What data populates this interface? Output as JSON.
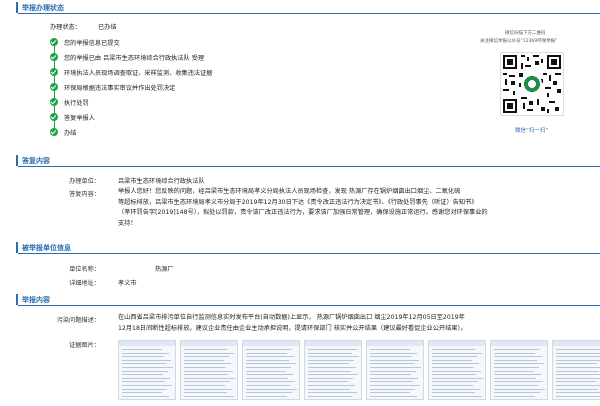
{
  "status_section": {
    "title": "举报办理状态",
    "status_label": "办理状态：",
    "status_value": "已办结",
    "steps": [
      "您的举报信息已提交",
      "您的举报已由 吕梁市生态环境综合行政执法队 受理",
      "环境执法人员现场调查取证、采样监测、收集违法证据",
      "环保局根据违法事实审议并作出处罚决定",
      "执行处罚",
      "答复举报人",
      "办结"
    ],
    "qr_line1": "微信扫描下方二维码",
    "qr_line2": "关注微信举报公众号“12369环保举报”",
    "qr_caption": "微信“扫一扫”"
  },
  "reply_section": {
    "title": "答复内容",
    "unit_label": "办理单位：",
    "unit_value": "吕梁市生态环境综合行政执法队",
    "content_label": "答复内容：",
    "content_lines": [
      "举报人您好！您反映的问题，经吕梁市生态环境局孝义分局执法人员现场检查，发现                  热源厂存在锅炉烟囱出口烟尘、二氧化硫",
      "等超标排放，吕梁市生态环境局孝义市分局于2019年12月30日下达《责令改正违法行为决定书》、《行政处罚事先（听证）告知书》",
      "（孝环罚告字[2019]148号），拟处以罚款，责令该厂改正违法行为，要求该厂加强日常管理，确保设施正常运行。感谢您对环保事业的",
      "支持！"
    ]
  },
  "unit_section": {
    "title": "被举报单位信息",
    "name_label": "单位名称：",
    "name_value": "热源厂",
    "address_label": "详细地址：",
    "address_value": "孝义市"
  },
  "report_section": {
    "title": "举报内容",
    "desc_label": "污染问题描述：",
    "desc_lines": [
      "在山西省吕梁市排污单位自行监测信息实时发布平台(自动数据)上显示，                 热源厂锅炉烟囱出口 烟尘2019年12月05日至2019年",
      "12月18日间断性超标排放。建议企业责任由企业主动承担说明，提请环保部门 核实并公开结果（建议最好看促企业公开结果）。"
    ],
    "evidence_label": "证据图片："
  }
}
